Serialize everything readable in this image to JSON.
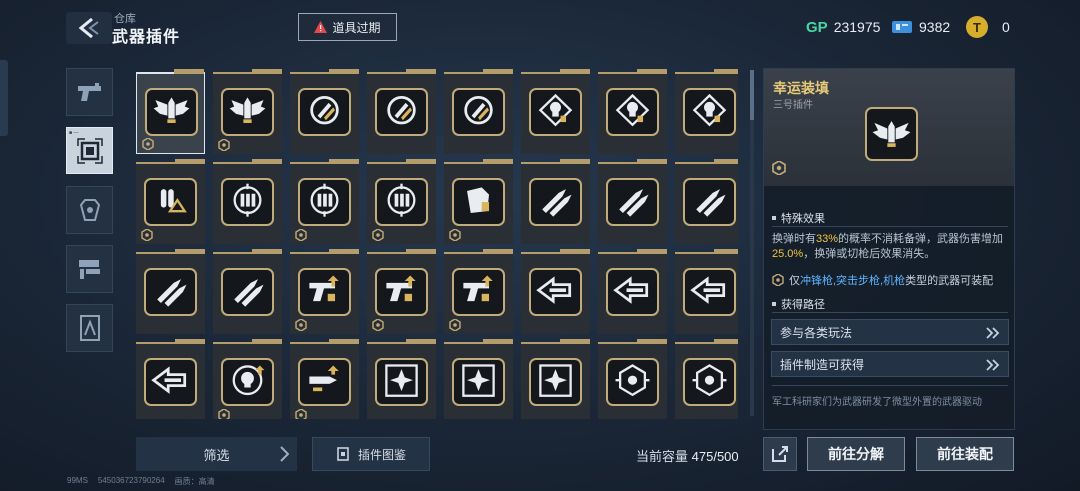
{
  "header": {
    "breadcrumb": "仓库",
    "title": "武器插件",
    "expire_button": "道具过期"
  },
  "currencies": [
    {
      "icon": "gp-icon",
      "label": "GP",
      "value": "231975"
    },
    {
      "icon": "ticket-icon",
      "value": "9382"
    },
    {
      "icon": "coin-icon",
      "value": "0"
    }
  ],
  "side_tabs": [
    {
      "icon": "pistol-icon",
      "active": false
    },
    {
      "icon": "plugin-chip-icon",
      "active": true
    },
    {
      "icon": "attachment-icon",
      "active": false
    },
    {
      "icon": "rifle-parts-icon",
      "active": false
    },
    {
      "icon": "tool-icon",
      "active": false
    }
  ],
  "plugins": [
    [
      "bullet-wings",
      "bullet-wings",
      "ammo-cycle",
      "ammo-cycle",
      "ammo-cycle",
      "skull-target",
      "skull-target",
      "skull-target"
    ],
    [
      "bullet-swap",
      "crosshair-bullets",
      "crosshair-bullets",
      "crosshair-bullets",
      "magazine-hand",
      "rocket-bullets",
      "rocket-bullets",
      "rocket-bullets"
    ],
    [
      "rocket-bullets",
      "rocket-bullets",
      "gun-upgrade",
      "gun-upgrade",
      "gun-upgrade",
      "arrow-hand",
      "arrow-hand",
      "arrow-hand"
    ],
    [
      "arrow-hand",
      "skull-upgrade",
      "bullet-upgrade",
      "diamond-spark",
      "diamond-spark",
      "diamond-spark",
      "target-ring",
      "target-ring"
    ]
  ],
  "bottom": {
    "filter": "筛选",
    "codex": "插件图鉴",
    "capacity_label": "当前容量",
    "capacity_value": "475/500",
    "decompose": "前往分解",
    "equip": "前往装配"
  },
  "footer": {
    "ping": "99MS",
    "uid": "545036723790264",
    "quality_label": "画质：",
    "quality": "高清"
  },
  "detail": {
    "name": "幸运装填",
    "subtitle": "三号插件",
    "effect_title": "特殊效果",
    "effect_line1_a": "换弹时有",
    "effect_chance": "33%",
    "effect_line1_b": "的概率不消耗备弹，武器伤害增加",
    "effect_bonus": "25.0%",
    "effect_line2": "，换弹或切枪后效果消失。",
    "restrict_prefix": "仅",
    "restrict_types": "冲锋枪,突击步枪,机枪",
    "restrict_suffix": "类型的武器可装配",
    "source_title": "获得路径",
    "routes": [
      "参与各类玩法",
      "插件制造可获得"
    ],
    "lore": "军工科研家们为武器研发了微型外置的武器驱动"
  }
}
